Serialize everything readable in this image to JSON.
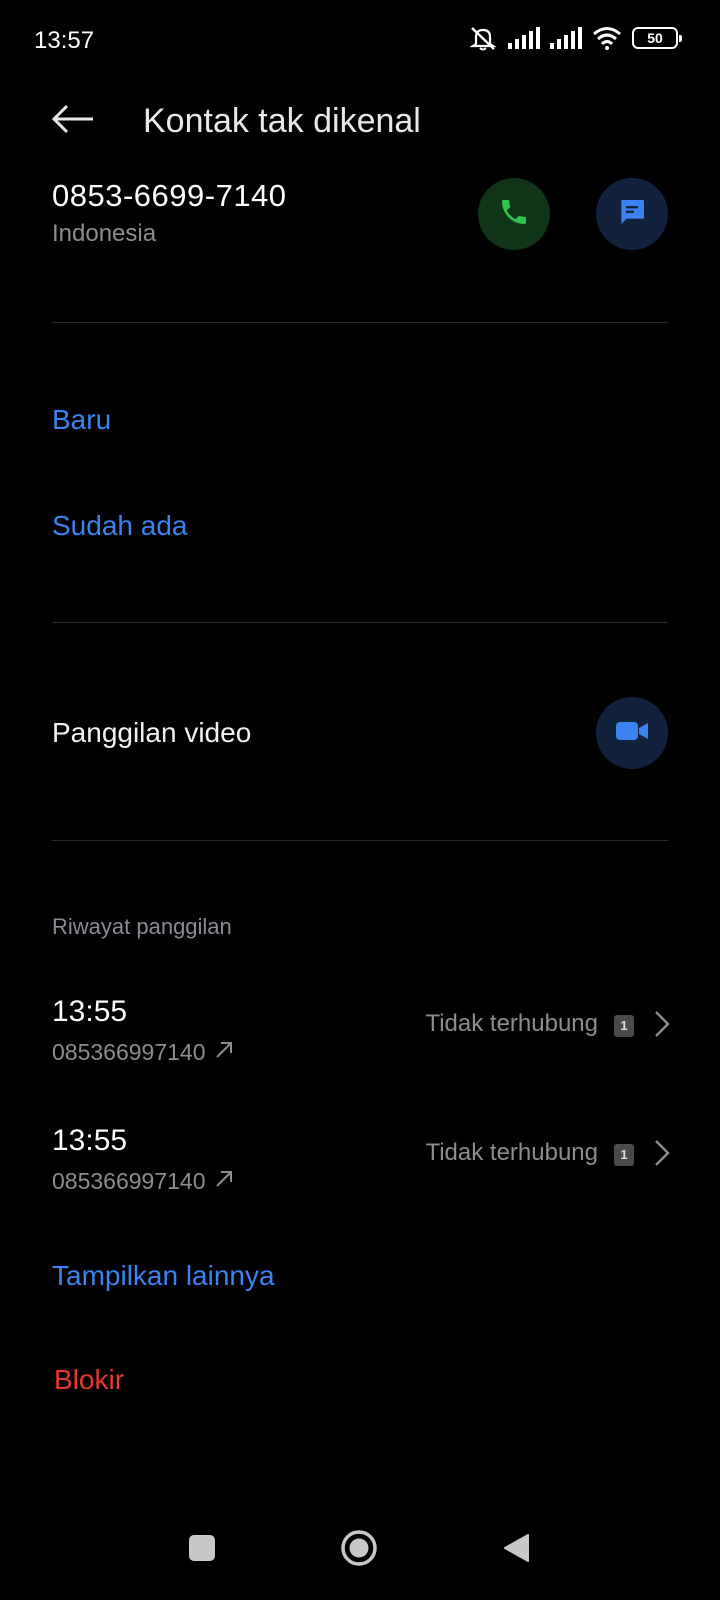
{
  "status_bar": {
    "time": "13:57",
    "battery": "50",
    "icons": [
      "mute-icon",
      "signal-icon",
      "signal-icon",
      "wifi-icon",
      "battery-icon"
    ]
  },
  "header": {
    "title": "Kontak tak dikenal",
    "back_icon": "arrow-left-icon"
  },
  "contact": {
    "number": "0853-6699-7140",
    "region": "Indonesia",
    "call_icon": "phone-icon",
    "message_icon": "message-icon"
  },
  "add_contact": {
    "new_label": "Baru",
    "existing_label": "Sudah ada"
  },
  "video": {
    "label": "Panggilan video",
    "icon": "video-camera-icon"
  },
  "history": {
    "section_label": "Riwayat panggilan",
    "calls": [
      {
        "time": "13:55",
        "number": "085366997140",
        "status": "Tidak terhubung",
        "sim": "1"
      },
      {
        "time": "13:55",
        "number": "085366997140",
        "status": "Tidak terhubung",
        "sim": "1"
      }
    ],
    "show_more_label": "Tampilkan lainnya"
  },
  "block_label": "Blokir",
  "colors": {
    "link_blue": "#3a83f1",
    "block_red": "#e2382e",
    "call_green": "#2fc34f",
    "call_bg": "#0f3416",
    "msg_bg": "#13223c"
  },
  "nav_bar": {
    "icons": [
      "recents-square-icon",
      "home-circle-icon",
      "back-triangle-icon"
    ]
  }
}
